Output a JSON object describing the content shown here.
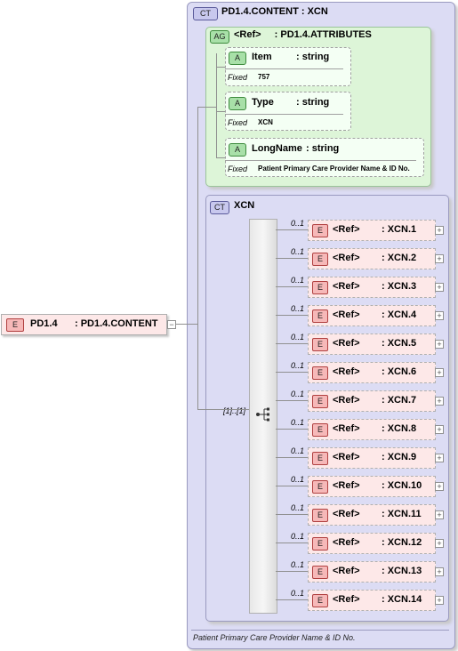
{
  "root": {
    "badge": "E",
    "name": "PD1.4",
    "type": ": PD1.4.CONTENT"
  },
  "complex_type": {
    "badge": "CT",
    "title": "PD1.4.CONTENT : XCN",
    "footer": "Patient Primary Care Provider Name & ID No."
  },
  "attribute_group": {
    "badge": "AG",
    "ref": "<Ref>",
    "type": ": PD1.4.ATTRIBUTES"
  },
  "attributes": [
    {
      "badge": "A",
      "name": "Item",
      "type": ": string",
      "fixed_label": "Fixed",
      "fixed_value": "757"
    },
    {
      "badge": "A",
      "name": "Type",
      "type": ": string",
      "fixed_label": "Fixed",
      "fixed_value": "XCN"
    },
    {
      "badge": "A",
      "name": "LongName",
      "type": ": string",
      "fixed_label": "Fixed",
      "fixed_value": "Patient Primary Care Provider Name & ID No."
    }
  ],
  "inner_type": {
    "badge": "CT",
    "title": "XCN",
    "sequence_occurrence": "[1]..[1]"
  },
  "elements": [
    {
      "badge": "E",
      "ref": "<Ref>",
      "type": ": XCN.1",
      "occurrence": "0..1"
    },
    {
      "badge": "E",
      "ref": "<Ref>",
      "type": ": XCN.2",
      "occurrence": "0..1"
    },
    {
      "badge": "E",
      "ref": "<Ref>",
      "type": ": XCN.3",
      "occurrence": "0..1"
    },
    {
      "badge": "E",
      "ref": "<Ref>",
      "type": ": XCN.4",
      "occurrence": "0..1"
    },
    {
      "badge": "E",
      "ref": "<Ref>",
      "type": ": XCN.5",
      "occurrence": "0..1"
    },
    {
      "badge": "E",
      "ref": "<Ref>",
      "type": ": XCN.6",
      "occurrence": "0..1"
    },
    {
      "badge": "E",
      "ref": "<Ref>",
      "type": ": XCN.7",
      "occurrence": "0..1"
    },
    {
      "badge": "E",
      "ref": "<Ref>",
      "type": ": XCN.8",
      "occurrence": "0..1"
    },
    {
      "badge": "E",
      "ref": "<Ref>",
      "type": ": XCN.9",
      "occurrence": "0..1"
    },
    {
      "badge": "E",
      "ref": "<Ref>",
      "type": ": XCN.10",
      "occurrence": "0..1"
    },
    {
      "badge": "E",
      "ref": "<Ref>",
      "type": ": XCN.11",
      "occurrence": "0..1"
    },
    {
      "badge": "E",
      "ref": "<Ref>",
      "type": ": XCN.12",
      "occurrence": "0..1"
    },
    {
      "badge": "E",
      "ref": "<Ref>",
      "type": ": XCN.13",
      "occurrence": "0..1"
    },
    {
      "badge": "E",
      "ref": "<Ref>",
      "type": ": XCN.14",
      "occurrence": "0..1"
    }
  ],
  "colors": {
    "complex_type_bg": "#dcdcf4",
    "attribute_group_bg": "#ddf5d8",
    "element_bg": "#fde8e8"
  }
}
